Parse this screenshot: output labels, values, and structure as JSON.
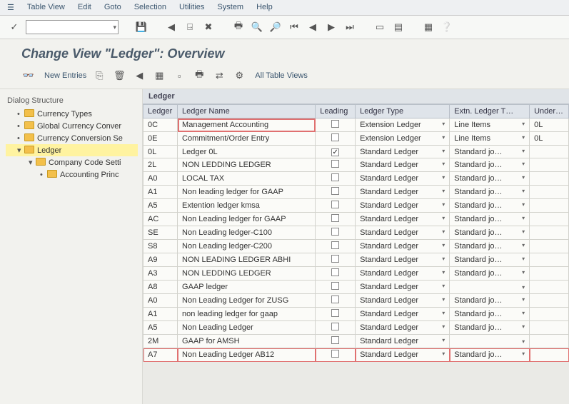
{
  "menu": {
    "items": [
      "Table View",
      "Edit",
      "Goto",
      "Selection",
      "Utilities",
      "System",
      "Help"
    ]
  },
  "toolbar1": {
    "icons": [
      "check",
      "",
      "save",
      "",
      "back",
      "exit",
      "cancel",
      "",
      "print",
      "find",
      "findnext",
      "firstpage",
      "prevpage",
      "nextpage",
      "lastpage",
      "",
      "newmode",
      "shortcut",
      "",
      "layout",
      "help"
    ]
  },
  "page": {
    "title": "Change View \"Ledger\": Overview"
  },
  "toolbar2": {
    "new_entries": "New Entries",
    "all_table_views": "All Table Views"
  },
  "sidebar": {
    "title": "Dialog Structure",
    "nodes": [
      {
        "label": "Currency Types",
        "ind": 1,
        "twist": "•"
      },
      {
        "label": "Global Currency Conver",
        "ind": 1,
        "twist": "•"
      },
      {
        "label": "Currency Conversion Se",
        "ind": 1,
        "twist": "•"
      },
      {
        "label": "Ledger",
        "ind": 1,
        "twist": "▾",
        "sel": true
      },
      {
        "label": "Company Code Setti",
        "ind": 2,
        "twist": "▾"
      },
      {
        "label": "Accounting Princ",
        "ind": 3,
        "twist": "•"
      }
    ]
  },
  "grid": {
    "title": "Ledger",
    "columns": [
      "Ledger",
      "Ledger Name",
      "Leading",
      "Ledger Type",
      "Extn. Ledger T…",
      "Under…"
    ],
    "rows": [
      {
        "c": "0C",
        "n": "Management Accounting",
        "l": false,
        "t": "Extension Ledger",
        "e": "Line Items",
        "u": "0L"
      },
      {
        "c": "0E",
        "n": "Commitment/Order Entry",
        "l": false,
        "t": "Extension Ledger",
        "e": "Line Items",
        "u": "0L"
      },
      {
        "c": "0L",
        "n": "Ledger 0L",
        "l": true,
        "t": "Standard Ledger",
        "e": "Standard jo…",
        "u": ""
      },
      {
        "c": "2L",
        "n": "NON LEDDING LEDGER",
        "l": false,
        "t": "Standard Ledger",
        "e": "Standard jo…",
        "u": ""
      },
      {
        "c": "A0",
        "n": "LOCAL TAX",
        "l": false,
        "t": "Standard Ledger",
        "e": "Standard jo…",
        "u": ""
      },
      {
        "c": "A1",
        "n": "Non leading ledger for GAAP",
        "l": false,
        "t": "Standard Ledger",
        "e": "Standard jo…",
        "u": ""
      },
      {
        "c": "A5",
        "n": "Extention ledger kmsa",
        "l": false,
        "t": "Standard Ledger",
        "e": "Standard jo…",
        "u": ""
      },
      {
        "c": "AC",
        "n": "Non Leading ledger for GAAP",
        "l": false,
        "t": "Standard Ledger",
        "e": "Standard jo…",
        "u": ""
      },
      {
        "c": "SE",
        "n": "Non Leading ledger-C100",
        "l": false,
        "t": "Standard Ledger",
        "e": "Standard jo…",
        "u": ""
      },
      {
        "c": "S8",
        "n": "Non Leading ledger-C200",
        "l": false,
        "t": "Standard Ledger",
        "e": "Standard jo…",
        "u": ""
      },
      {
        "c": "A9",
        "n": "NON LEADING LEDGER ABHI",
        "l": false,
        "t": "Standard Ledger",
        "e": "Standard jo…",
        "u": ""
      },
      {
        "c": "A3",
        "n": "NON LEDDING LEDGER",
        "l": false,
        "t": "Standard Ledger",
        "e": "Standard jo…",
        "u": ""
      },
      {
        "c": "A8",
        "n": "GAAP ledger",
        "l": false,
        "t": "Standard Ledger",
        "e": "",
        "u": ""
      },
      {
        "c": "A0",
        "n": "Non Leading Ledger for ZUSG",
        "l": false,
        "t": "Standard Ledger",
        "e": "Standard jo…",
        "u": ""
      },
      {
        "c": "A1",
        "n": "non leading ledger for gaap",
        "l": false,
        "t": "Standard Ledger",
        "e": "Standard jo…",
        "u": ""
      },
      {
        "c": "A5",
        "n": "Non Leading Ledger",
        "l": false,
        "t": "Standard Ledger",
        "e": "Standard jo…",
        "u": ""
      },
      {
        "c": "2M",
        "n": "GAAP for AMSH",
        "l": false,
        "t": "Standard Ledger",
        "e": "",
        "u": ""
      },
      {
        "c": "A7",
        "n": "Non Leading Ledger AB12",
        "l": false,
        "t": "Standard Ledger",
        "e": "Standard jo…",
        "u": ""
      }
    ]
  },
  "glyphs": {
    "check": "✓",
    "save": "💾",
    "back": "◀",
    "exit": "⍈",
    "cancel": "✖",
    "print": "🖶",
    "find": "🔍",
    "findnext": "🔎",
    "firstpage": "⏮",
    "prevpage": "◀",
    "nextpage": "▶",
    "lastpage": "⏭",
    "newmode": "▭",
    "shortcut": "▤",
    "layout": "▦",
    "help": "❔",
    "eyeglasses": "👓",
    "copy": "⎘",
    "delete": "🗑",
    "selectall": "▦",
    "deselect": "▫",
    "bctoggle": "⇄",
    "config": "⚙",
    "dd": "▾",
    "folder": ""
  }
}
